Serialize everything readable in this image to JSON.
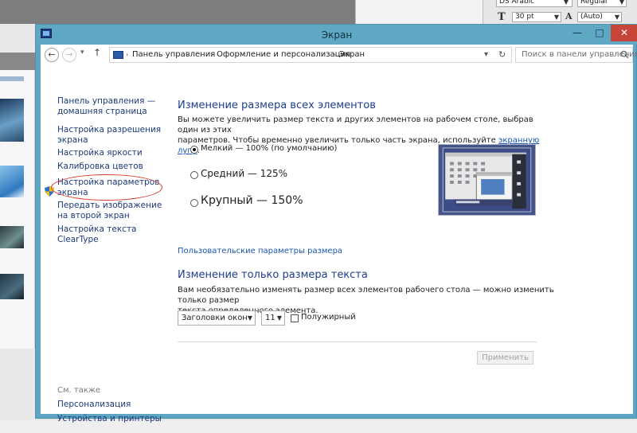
{
  "photoshop": {
    "font_family": "DS Arabic",
    "font_style": "Regular",
    "font_size": "30 pt",
    "leading": "(Auto)"
  },
  "window": {
    "title": "Экран",
    "buttons": {
      "minimize": "—",
      "maximize": "□",
      "close": "✕"
    }
  },
  "address_bar": {
    "breadcrumb": [
      "Панель управления",
      "Оформление и персонализация",
      "Экран"
    ],
    "separator": "›",
    "search_placeholder": "Поиск в панели управления"
  },
  "sidebar": {
    "home": "Панель управления — домашняя страница",
    "links": [
      "Настройка разрешения экрана",
      "Настройка яркости",
      "Калибровка цветов",
      "Настройка параметров экрана",
      "Передать изображение на второй экран",
      "Настройка текста ClearType"
    ],
    "see_also_title": "См. также",
    "see_also": [
      "Персонализация",
      "Устройства и принтеры"
    ]
  },
  "main": {
    "heading1": "Изменение размера всех элементов",
    "para1_line1": "Вы можете увеличить размер текста и других элементов на рабочем столе, выбрав один из этих",
    "para1_line2_prefix": "параметров. Чтобы временно увеличить только часть экрана, используйте ",
    "para1_link": "экранную лупу",
    "para1_suffix": ".",
    "options": [
      {
        "label": "Мелкий — 100% (по умолчанию)",
        "selected": true
      },
      {
        "label": "Средний — 125%",
        "selected": false
      },
      {
        "label": "Крупный — 150%",
        "selected": false
      }
    ],
    "custom_link": "Пользовательские параметры размера",
    "heading2": "Изменение только размера текста",
    "para2_line1": "Вам необязательно изменять размер всех элементов рабочего стола — можно изменить только размер",
    "para2_line2": "текста определенного элемента.",
    "element_select": "Заголовки окон",
    "size_select": "11",
    "bold_label": "Полужирный",
    "bold_checked": false,
    "apply_button": "Применить"
  },
  "colors": {
    "titlebar": "#5fa8c4",
    "link": "#1c3a7a",
    "heading": "#1e3d8c",
    "annotation_oval": "#d63a2a"
  }
}
